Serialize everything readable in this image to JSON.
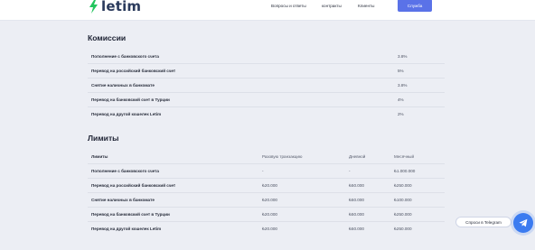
{
  "header": {
    "logo_text": "letim",
    "nav": [
      "Вопросы и ответы",
      "контракты",
      "Клиенты"
    ],
    "help_button": "Служба"
  },
  "commissions": {
    "title": "Комиссии",
    "rows": [
      {
        "label": "Пополнение с банковского счета",
        "value": "3.8%"
      },
      {
        "label": "Перевод на российский банковский счет",
        "value": "5%"
      },
      {
        "label": "Снятие наличных в банкомате",
        "value": "3.8%"
      },
      {
        "label": "Перевод на банковский счет в Турции",
        "value": "4%"
      },
      {
        "label": "Перевод на другой кошелек Letim",
        "value": "2%"
      }
    ]
  },
  "limits": {
    "title": "Лимиты",
    "headers": [
      "Лимиты",
      "Разовую транзакцию",
      "Дневной",
      "Месячный"
    ],
    "rows": [
      {
        "label": "Пополнение с банковского счета",
        "single": "-",
        "daily": "-",
        "monthly": "₺1.000.000"
      },
      {
        "label": "Перевод на российский банковский счет",
        "single": "₺20.000",
        "daily": "₺50.000",
        "monthly": "₺250.000"
      },
      {
        "label": "Снятие наличных в банкомате",
        "single": "₺20.000",
        "daily": "₺50.000",
        "monthly": "₺100.000"
      },
      {
        "label": "Перевод на банковский счет в Турции",
        "single": "₺20.000",
        "daily": "₺50.000",
        "monthly": "₺250.000"
      },
      {
        "label": "Перевод на другой кошелек Letim",
        "single": "₺20.000",
        "daily": "₺50.000",
        "monthly": "₺250.000"
      }
    ]
  },
  "telegram": {
    "label": "Спроси в Telegram"
  },
  "colors": {
    "accent": "#5a72e8",
    "telegram": "#3b7bf0",
    "logo_green": "#22c55e",
    "background": "#eceef4"
  }
}
